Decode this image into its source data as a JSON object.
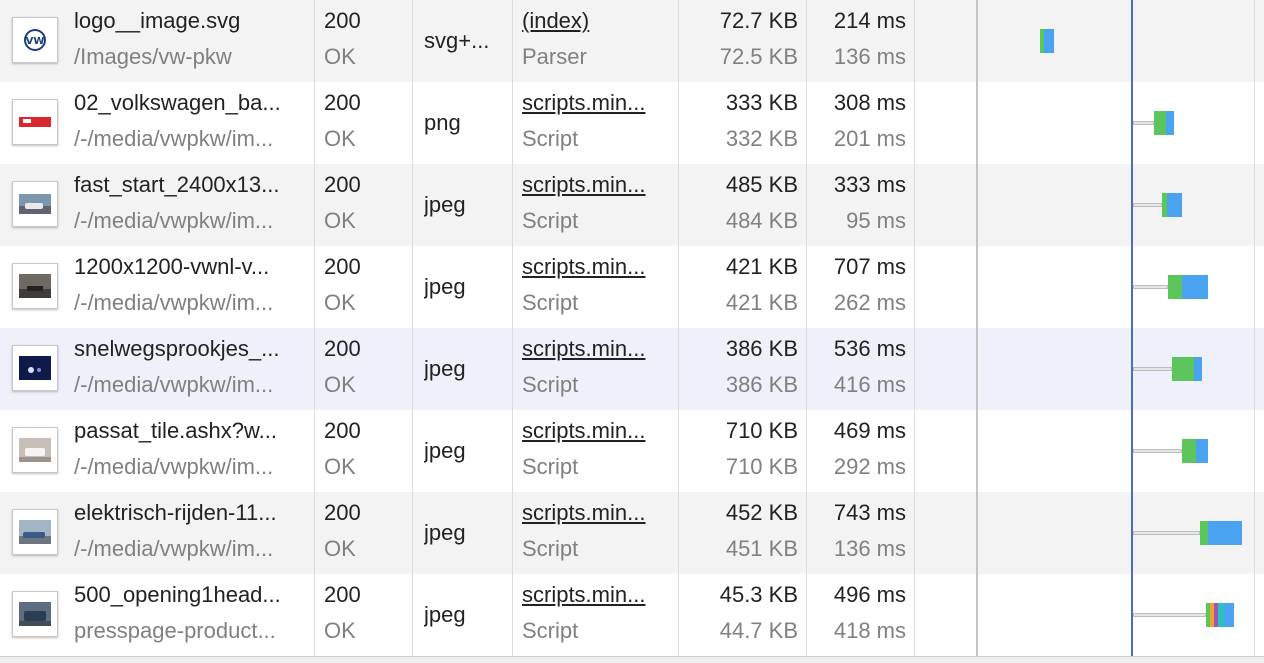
{
  "colors": {
    "download": "#4aa3f0",
    "ttfb": "#5cc65c",
    "queue": "#9b59b6",
    "stalled": "#f0a030",
    "dns": "#2ebfbf"
  },
  "rows": [
    {
      "name": "logo__image.svg",
      "path": "/Images/vw-pkw",
      "status": "200",
      "status_text": "OK",
      "type": "svg+...",
      "initiator": "(index)",
      "initiator_type": "Parser",
      "size": "72.7 KB",
      "content": "72.5 KB",
      "time": "214 ms",
      "latency": "136 ms",
      "thumb_icon": "vw-logo-icon",
      "waterfall": {
        "wait_start": 0,
        "green_start": 1040,
        "green_end": 1044,
        "blue_end": 1054
      }
    },
    {
      "name": "02_volkswagen_ba...",
      "path": "/-/media/vwpkw/im...",
      "status": "200",
      "status_text": "OK",
      "type": "png",
      "initiator": "scripts.min...",
      "initiator_type": "Script",
      "size": "333 KB",
      "content": "332 KB",
      "time": "308 ms",
      "latency": "201 ms",
      "thumb_icon": "banner-thumbnail-icon",
      "waterfall": {
        "wait_start": 1133,
        "green_start": 1154,
        "green_end": 1166,
        "blue_end": 1174
      }
    },
    {
      "name": "fast_start_2400x13...",
      "path": "/-/media/vwpkw/im...",
      "status": "200",
      "status_text": "OK",
      "type": "jpeg",
      "initiator": "scripts.min...",
      "initiator_type": "Script",
      "size": "485 KB",
      "content": "484 KB",
      "time": "333 ms",
      "latency": "95 ms",
      "thumb_icon": "car-thumbnail-icon",
      "waterfall": {
        "wait_start": 1133,
        "green_start": 1162,
        "green_end": 1167,
        "blue_end": 1182
      }
    },
    {
      "name": "1200x1200-vwnl-v...",
      "path": "/-/media/vwpkw/im...",
      "status": "200",
      "status_text": "OK",
      "type": "jpeg",
      "initiator": "scripts.min...",
      "initiator_type": "Script",
      "size": "421 KB",
      "content": "421 KB",
      "time": "707 ms",
      "latency": "262 ms",
      "thumb_icon": "street-thumbnail-icon",
      "waterfall": {
        "wait_start": 1133,
        "green_start": 1168,
        "green_end": 1182,
        "blue_end": 1208
      }
    },
    {
      "name": "snelwegsprookjes_...",
      "path": "/-/media/vwpkw/im...",
      "status": "200",
      "status_text": "OK",
      "type": "jpeg",
      "initiator": "scripts.min...",
      "initiator_type": "Script",
      "size": "386 KB",
      "content": "386 KB",
      "time": "536 ms",
      "latency": "416 ms",
      "thumb_icon": "night-road-thumbnail-icon",
      "waterfall": {
        "wait_start": 1133,
        "green_start": 1172,
        "green_end": 1194,
        "blue_end": 1202
      }
    },
    {
      "name": "passat_tile.ashx?w...",
      "path": "/-/media/vwpkw/im...",
      "status": "200",
      "status_text": "OK",
      "type": "jpeg",
      "initiator": "scripts.min...",
      "initiator_type": "Script",
      "size": "710 KB",
      "content": "710 KB",
      "time": "469 ms",
      "latency": "292 ms",
      "thumb_icon": "passat-thumbnail-icon",
      "waterfall": {
        "wait_start": 1133,
        "green_start": 1182,
        "green_end": 1196,
        "blue_end": 1208
      }
    },
    {
      "name": "elektrisch-rijden-11...",
      "path": "/-/media/vwpkw/im...",
      "status": "200",
      "status_text": "OK",
      "type": "jpeg",
      "initiator": "scripts.min...",
      "initiator_type": "Script",
      "size": "452 KB",
      "content": "451 KB",
      "time": "743 ms",
      "latency": "136 ms",
      "thumb_icon": "electric-car-thumbnail-icon",
      "waterfall": {
        "wait_start": 1133,
        "green_start": 1200,
        "green_end": 1208,
        "blue_end": 1242
      }
    },
    {
      "name": "500_opening1head...",
      "path": "presspage-product...",
      "status": "200",
      "status_text": "OK",
      "type": "jpeg",
      "initiator": "scripts.min...",
      "initiator_type": "Script",
      "size": "45.3 KB",
      "content": "44.7 KB",
      "time": "496 ms",
      "latency": "418 ms",
      "thumb_icon": "suv-thumbnail-icon",
      "waterfall": {
        "wait_start": 1133,
        "green_start": 1206,
        "green_end": 1224,
        "blue_end": 1234,
        "multi": true
      }
    }
  ]
}
